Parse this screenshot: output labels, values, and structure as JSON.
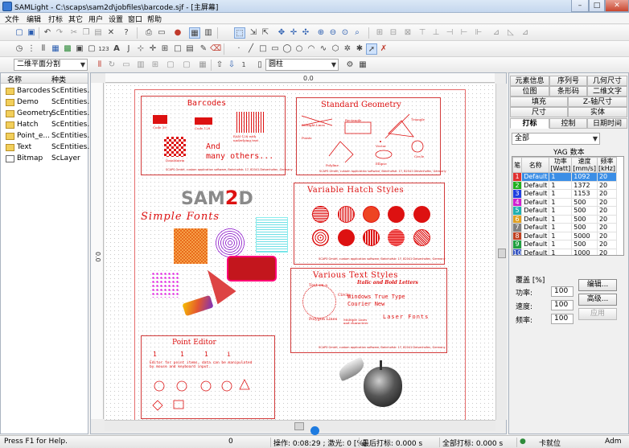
{
  "window": {
    "title": "SAMLight - C:\\scaps\\sam2d\\jobfiles\\barcode.sjf - [主屏幕]",
    "min": "–",
    "max": "□",
    "close": "✕"
  },
  "menu": [
    "文件",
    "编辑",
    "打标",
    "其它",
    "用户",
    "设置",
    "窗口",
    "帮助"
  ],
  "toolbar": {
    "combo_mode": "二维平面分割",
    "combo_shape": "圆柱",
    "num_label": "1"
  },
  "entity_list": {
    "headers": {
      "name": "名称",
      "type": "种类"
    },
    "rows": [
      {
        "name": "Barcodes",
        "type": "ScEntities..."
      },
      {
        "name": "Demo",
        "type": "ScEntities..."
      },
      {
        "name": "Geometry",
        "type": "ScEntities..."
      },
      {
        "name": "Hatch",
        "type": "ScEntities..."
      },
      {
        "name": "Point_e...",
        "type": "ScEntities..."
      },
      {
        "name": "Text",
        "type": "ScEntities..."
      },
      {
        "name": "Bitmap",
        "type": "ScLayer"
      }
    ]
  },
  "canvas": {
    "ruler_top": "0.0",
    "ruler_left": "0.0",
    "barcodes": {
      "title": "Barcodes",
      "code39": "Code 39",
      "code128": "Code 128",
      "datamatrix": "DataMatrix",
      "ean": "EAN-128 with\nunderlying text",
      "and_many": "And\nmany others..."
    },
    "geometry": {
      "title": "Standard Geometry",
      "straight": "Straight Lines",
      "rectangle": "Rectangle",
      "triangle": "Triangle",
      "points": "Points",
      "vector": "Vector",
      "polyline": "Polyline",
      "circle": "Circle",
      "ellipse": "Ellipse"
    },
    "logo": {
      "sam": "SAM",
      "two": "2",
      "d": "D"
    },
    "simple_fonts": "Simple Fonts",
    "hatch": {
      "title": "Variable Hatch Styles"
    },
    "text_styles": {
      "title": "Various Text Styles",
      "italic": "Italic and Bold Letters",
      "windows_tt": "Windows True Type",
      "courier": "Courier New",
      "laser_fonts": "Laser Fonts",
      "multiline": "Multiple Lines\nand characters",
      "arc1": "Text on a",
      "arc2": "Circle",
      "poly": "Polygon Lines"
    },
    "point_editor": {
      "title": "Point Editor",
      "digits": [
        "1",
        "1",
        "1",
        "i"
      ],
      "desc": "Editor for point items, data can be manipulated\nby mouse and keyboard input."
    },
    "footer": "SCAPS GmbH, custom application software, Bahnhofstr. 17, 82041 Deisenhofen, Germany"
  },
  "right_panel": {
    "tabs_row1": [
      "元素信息",
      "序列号",
      "几何尺寸"
    ],
    "tabs_row2": [
      "位图",
      "条形码",
      "二维文字"
    ],
    "tabs_row3": [
      "填充",
      "Z-轴尺寸"
    ],
    "tabs_row4": [
      "尺寸",
      "实体"
    ],
    "tabs_row5": [
      "打标",
      "控制",
      "日期时间"
    ],
    "filter": "全部",
    "yag_label": "YAG 数本",
    "table_headers": [
      "笔",
      "名称",
      "功率\n[Watt]",
      "速度\n[mm/s]",
      "频率\n[kHz]"
    ],
    "table_rows": [
      {
        "n": "1",
        "color": "#e03030",
        "name": "Default",
        "p": "1",
        "s": "1092",
        "f": "20",
        "selected": true
      },
      {
        "n": "2",
        "color": "#20b020",
        "name": "Default",
        "p": "1",
        "s": "1372",
        "f": "20"
      },
      {
        "n": "3",
        "color": "#2040e0",
        "name": "Default",
        "p": "1",
        "s": "1153",
        "f": "20"
      },
      {
        "n": "4",
        "color": "#d020d0",
        "name": "Default",
        "p": "1",
        "s": "500",
        "f": "20"
      },
      {
        "n": "5",
        "color": "#20b0b0",
        "name": "Default",
        "p": "1",
        "s": "500",
        "f": "20"
      },
      {
        "n": "6",
        "color": "#e0a020",
        "name": "Default",
        "p": "1",
        "s": "500",
        "f": "20"
      },
      {
        "n": "7",
        "color": "#808080",
        "name": "Default",
        "p": "1",
        "s": "500",
        "f": "20"
      },
      {
        "n": "8",
        "color": "#c04020",
        "name": "Default",
        "p": "1",
        "s": "5000",
        "f": "20"
      },
      {
        "n": "9",
        "color": "#20a040",
        "name": "Default",
        "p": "1",
        "s": "500",
        "f": "20"
      },
      {
        "n": "10",
        "color": "#3050c0",
        "name": "Default",
        "p": "1",
        "s": "1000",
        "f": "20"
      }
    ],
    "override_label": "覆盖 [%]",
    "power_label": "功率:",
    "speed_label": "速度:",
    "freq_label": "频率:",
    "power_val": "100",
    "speed_val": "100",
    "freq_val": "100",
    "edit_btn": "编辑...",
    "adv_btn": "高级...",
    "apply_btn": "应用"
  },
  "status": {
    "help": "Press F1 for Help.",
    "zero": "0",
    "op": "操作: 0:08:29 ; 激光: 0 [%]",
    "last": "最后打标: 0.000 s",
    "total": "全部打标: 0.000 s",
    "ready": "卡就位",
    "user": "Adm"
  },
  "colors": {
    "accent": "#d11111",
    "selection": "#3b8ee6",
    "logo_gray": "#8a8a8a"
  }
}
